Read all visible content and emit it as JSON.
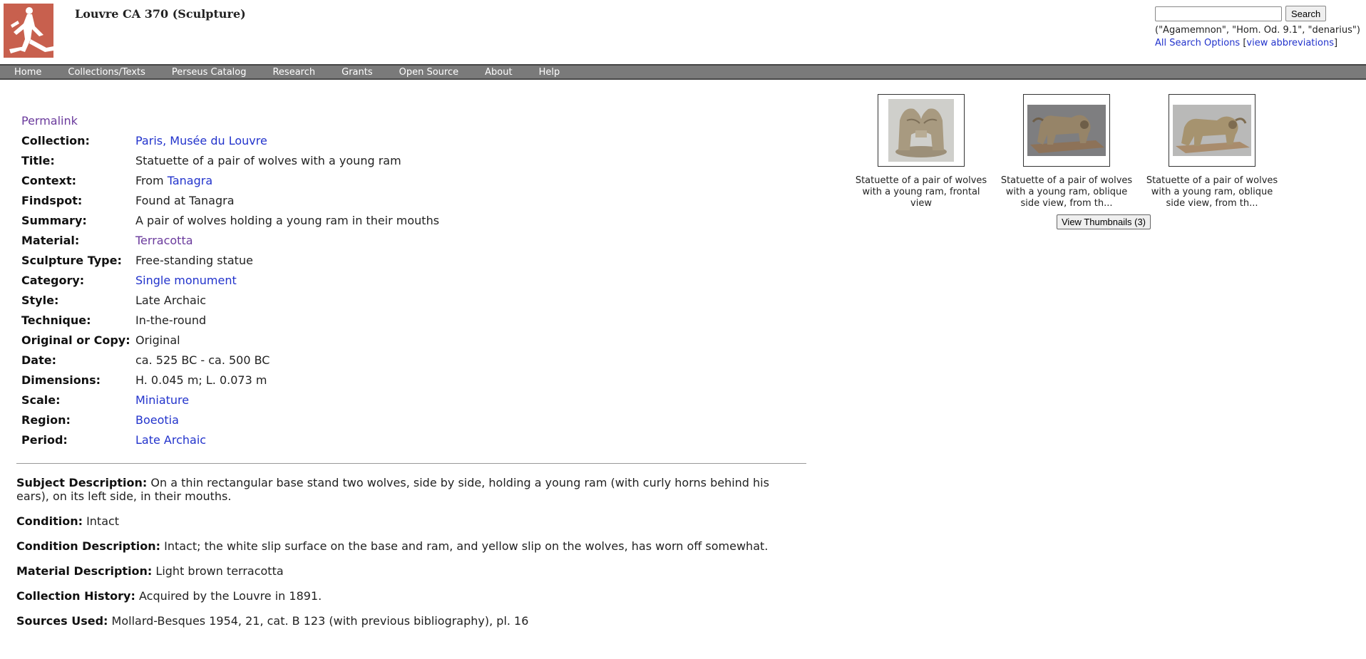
{
  "header": {
    "title": "Louvre CA 370 (Sculpture)"
  },
  "search": {
    "value": "",
    "placeholder": "",
    "button_label": "Search",
    "hint": "(\"Agamemnon\", \"Hom. Od. 9.1\", \"denarius\")",
    "options_link": "All Search Options",
    "bracket_open": " [",
    "abbrev_link": "view abbreviations",
    "bracket_close": "]"
  },
  "nav": {
    "items": [
      "Home",
      "Collections/Texts",
      "Perseus Catalog",
      "Research",
      "Grants",
      "Open Source",
      "About",
      "Help"
    ]
  },
  "meta": {
    "permalink": "Permalink",
    "rows": [
      {
        "label": "Collection:",
        "value": "Paris, Musée du Louvre"
      },
      {
        "label": "Title:",
        "value": "Statuette of a pair of wolves with a young ram"
      },
      {
        "label": "Context:",
        "prefix": "From ",
        "value": "Tanagra"
      },
      {
        "label": "Findspot:",
        "value": "Found at Tanagra"
      },
      {
        "label": "Summary:",
        "value": "A pair of wolves holding a young ram in their mouths"
      },
      {
        "label": "Material:",
        "value": "Terracotta"
      },
      {
        "label": "Sculpture Type:",
        "value": "Free-standing statue"
      },
      {
        "label": "Category:",
        "value": "Single monument"
      },
      {
        "label": "Style:",
        "value": "Late Archaic"
      },
      {
        "label": "Technique:",
        "value": "In-the-round"
      },
      {
        "label": "Original or Copy:",
        "value": "Original"
      },
      {
        "label": "Date:",
        "value": "ca. 525 BC - ca. 500 BC"
      },
      {
        "label": "Dimensions:",
        "value": "H. 0.045 m; L. 0.073 m"
      },
      {
        "label": "Scale:",
        "value": "Miniature"
      },
      {
        "label": "Region:",
        "value": "Boeotia"
      },
      {
        "label": "Period:",
        "value": "Late Archaic"
      }
    ]
  },
  "descriptions": [
    {
      "label": "Subject Description:",
      "text": " On a thin rectangular base stand two wolves, side by side, holding a young ram (with curly horns behind his ears), on its left side, in their mouths."
    },
    {
      "label": "Condition:",
      "text": " Intact"
    },
    {
      "label": "Condition Description:",
      "text": " Intact; the white slip surface on the base and ram, and yellow slip on the wolves, has worn off somewhat."
    },
    {
      "label": "Material Description:",
      "text": " Light brown terracotta"
    },
    {
      "label": "Collection History:",
      "text": " Acquired by the Louvre in 1891."
    },
    {
      "label": "Sources Used:",
      "text": " Mollard-Besques 1954, 21, cat. B 123 (with previous bibliography), pl. 16"
    }
  ],
  "thumbnails": {
    "items": [
      {
        "caption": "Statuette of a pair of wolves with a young ram, frontal view"
      },
      {
        "caption": "Statuette of a pair of wolves with a young ram, oblique side view, from th..."
      },
      {
        "caption": "Statuette of a pair of wolves with a young ram, oblique side view, from th..."
      }
    ],
    "view_button": "View Thumbnails (3)"
  },
  "colors": {
    "link": "#2233cc",
    "visited_link": "#6a3a9c",
    "nav_bg": "#7a7a7a",
    "logo_bg": "#c8604e"
  }
}
